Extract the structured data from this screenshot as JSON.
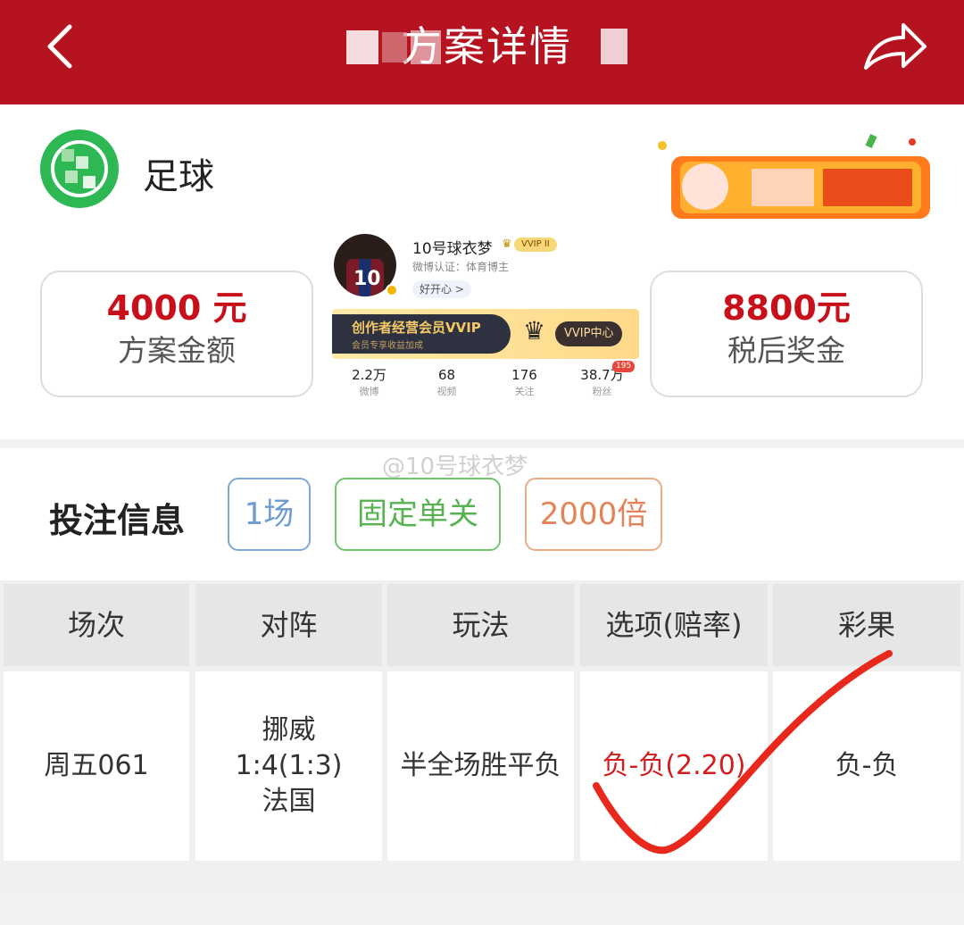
{
  "header": {
    "title": "方案详情",
    "bg_color": "#b5131f"
  },
  "shop": {
    "name": "足球"
  },
  "amounts": {
    "plan_amount": "4000 元",
    "plan_amount_label": "方案金额",
    "prize_amount": "8800元",
    "prize_amount_label": "税后奖金"
  },
  "profile": {
    "name": "10号球衣梦",
    "vip": "VVIP II",
    "certification": "微博认证：体育博主",
    "mood": "好开心 >",
    "banner_title": "创作者经营会员VVIP",
    "banner_sub": "会员专享收益加成",
    "banner_button": "VVIP中心",
    "jersey_number": "10",
    "stats": [
      {
        "value": "2.2万",
        "label": "微博"
      },
      {
        "value": "68",
        "label": "视频"
      },
      {
        "value": "176",
        "label": "关注"
      },
      {
        "value": "38.7万",
        "label": "粉丝"
      }
    ],
    "fans_badge": "195"
  },
  "watermark": "@10号球衣梦",
  "bet": {
    "title": "投注信息",
    "tag_count": "1场",
    "tag_type": "固定单关",
    "tag_multiplier": "2000倍"
  },
  "table": {
    "headers": [
      "场次",
      "对阵",
      "玩法",
      "选项(赔率)",
      "彩果"
    ],
    "row": {
      "match_no": "周五061",
      "home": "挪威",
      "score": "1:4(1:3)",
      "away": "法国",
      "play_type": "半全场胜平负",
      "selection": "负-负(2.20)",
      "result": "负-负"
    }
  },
  "colors": {
    "accent_red": "#c8101a",
    "check_red": "#e8281c"
  }
}
